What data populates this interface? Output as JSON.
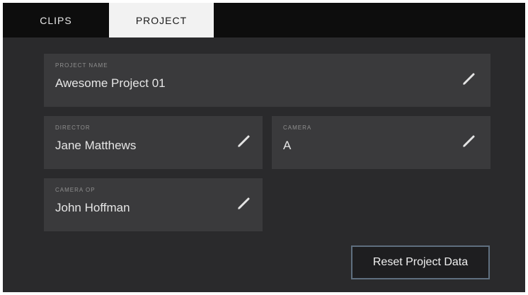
{
  "tabs": {
    "clips": "CLIPS",
    "project": "PROJECT",
    "active": "PROJECT"
  },
  "fields": {
    "project_name": {
      "label": "PROJECT NAME",
      "value": "Awesome Project 01"
    },
    "director": {
      "label": "DIRECTOR",
      "value": "Jane Matthews"
    },
    "camera": {
      "label": "CAMERA",
      "value": "A"
    },
    "camera_op": {
      "label": "CAMERA OP",
      "value": "John Hoffman"
    }
  },
  "actions": {
    "reset_label": "Reset Project Data"
  },
  "icons": {
    "edit": "pencil-icon"
  },
  "colors": {
    "background": "#2a2a2c",
    "field_background": "#3a3a3c",
    "tabbar_background": "#0d0d0d",
    "active_tab": "#f2f2f2",
    "button_border": "#5f6f7f"
  }
}
